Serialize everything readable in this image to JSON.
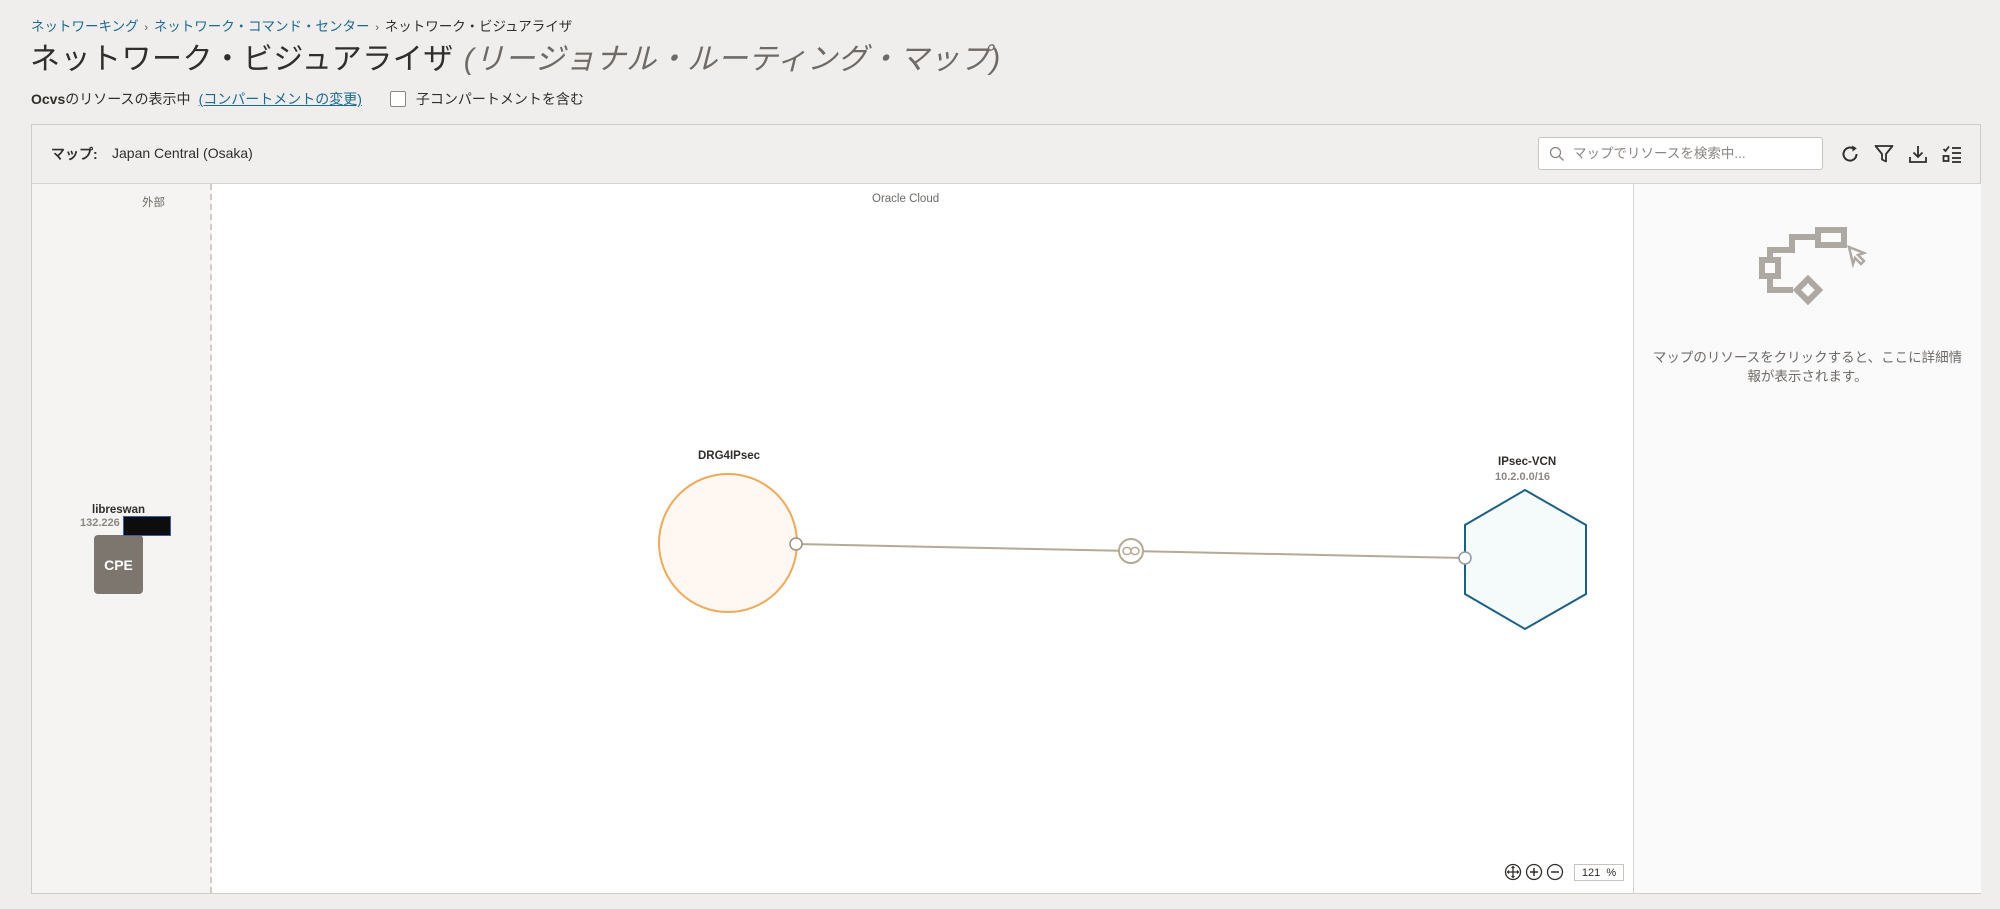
{
  "breadcrumb": {
    "item1": "ネットワーキング",
    "item2": "ネットワーク・コマンド・センター",
    "current": "ネットワーク・ビジュアライザ",
    "separator": "›"
  },
  "page": {
    "title": "ネットワーク・ビジュアライザ",
    "subtitle": "(リージョナル・ルーティング・マップ)"
  },
  "scope": {
    "compartment": "Ocvs",
    "text": "のリソースの表示中",
    "change_link": "(コンパートメントの変更)",
    "include_children_label": "子コンパートメントを含む",
    "include_children_checked": false
  },
  "toolbar": {
    "map_label": "マップ:",
    "map_value": "Japan Central (Osaka)",
    "search_placeholder": "マップでリソースを検索中...",
    "icons": [
      "refresh-icon",
      "filter-icon",
      "download-icon",
      "legend-icon"
    ]
  },
  "map": {
    "external_label": "外部",
    "oracle_cloud_label": "Oracle Cloud",
    "cpe": {
      "name": "libreswan",
      "ip": "132.226",
      "badge": "CPE"
    },
    "drg": {
      "name": "DRG4IPsec"
    },
    "vcn": {
      "name": "IPsec-VCN",
      "cidr": "10.2.0.0/16"
    },
    "attachment_icon": "link-icon",
    "zoom_value": "121",
    "zoom_unit": "%"
  },
  "details_panel": {
    "hint": "マップのリソースをクリックすると、ここに詳細情報が表示されます。"
  },
  "colors": {
    "link": "#1d6a94",
    "drg_stroke": "#f0a958",
    "drg_fill": "#fff8f2",
    "vcn_stroke": "#1c6085",
    "vcn_fill": "#f5fafb",
    "connector": "#b5aa95"
  }
}
